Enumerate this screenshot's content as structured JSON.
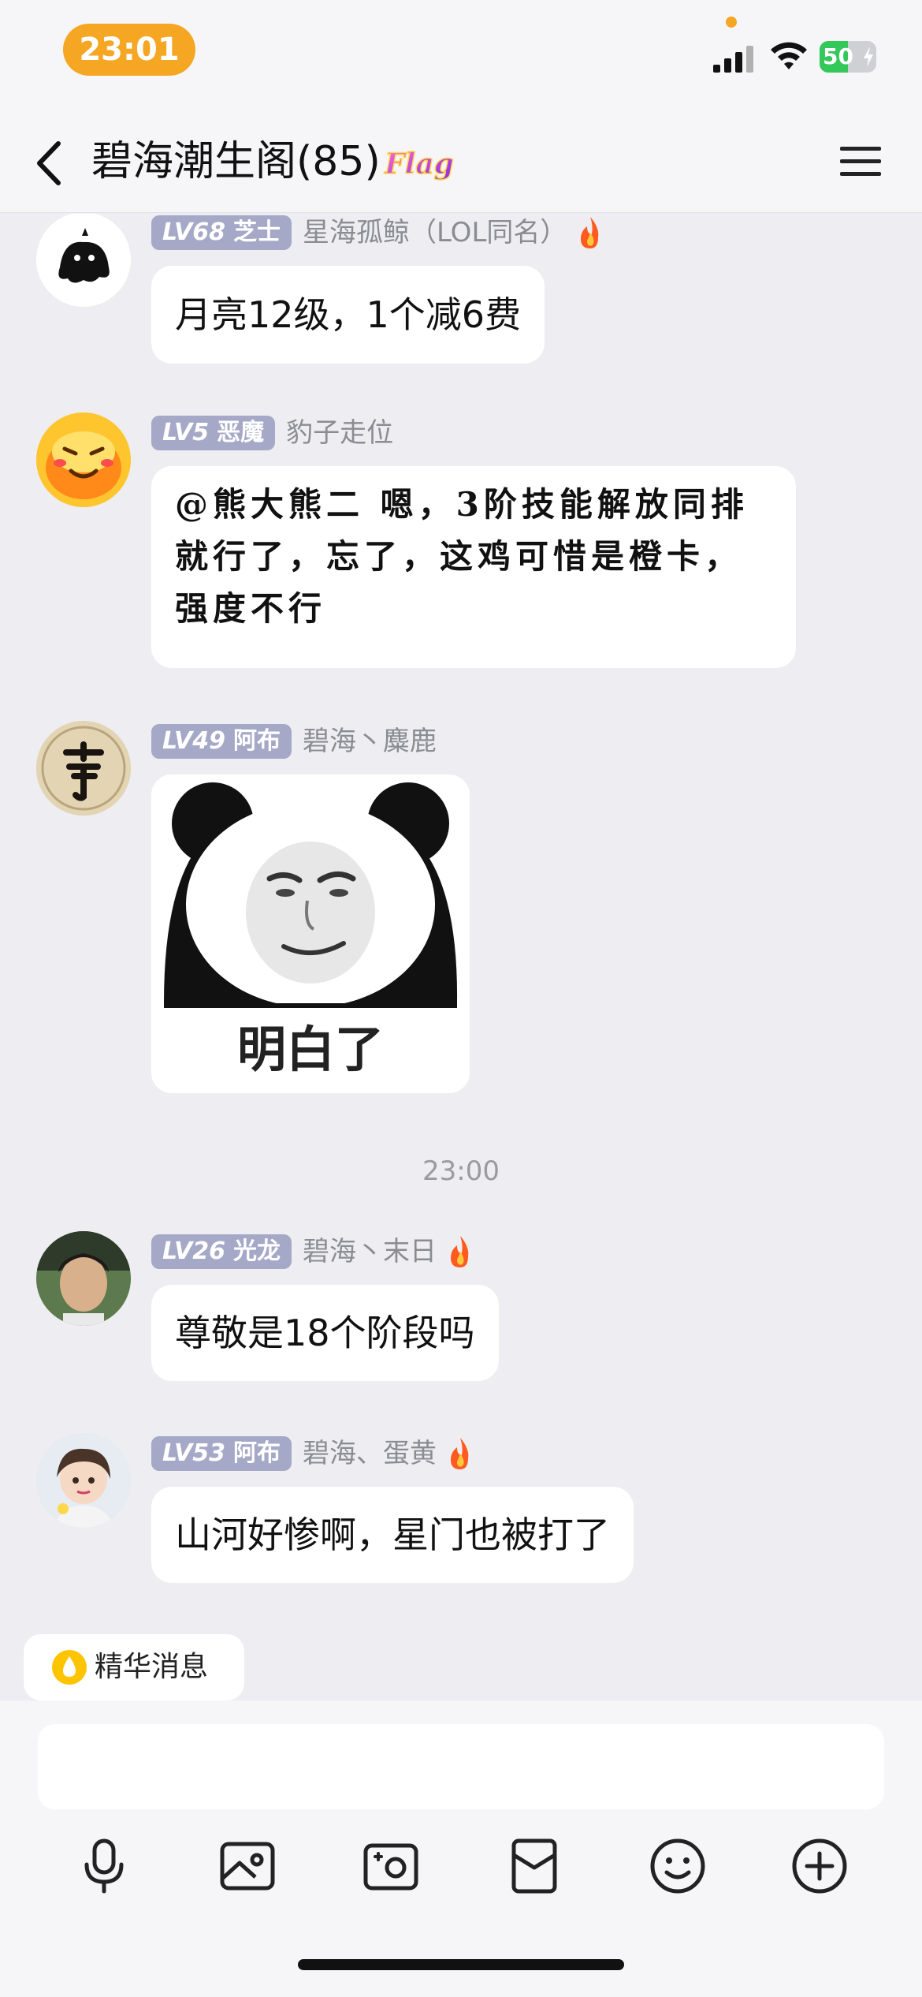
{
  "status_bar": {
    "time": "23:01",
    "battery": "50",
    "battery_level": 0.5,
    "colors": {
      "time_pill": "#f5a623",
      "battery": "#34c759"
    }
  },
  "header": {
    "title": "碧海潮生阁(85)",
    "badge_text": "Flag",
    "back_icon": "chevron-left-icon",
    "menu_icon": "hamburger-menu-icon"
  },
  "messages": [
    {
      "level": "LV68",
      "title": "芝士",
      "nickname": "星海孤鲸（LOL同名）",
      "hot": true,
      "text": "月亮12级，1个减6费"
    },
    {
      "level": "LV5",
      "title": "恶魔",
      "nickname": "豹子走位",
      "hot": false,
      "text": "@熊大熊二 嗯，3阶技能解放同排就行了，忘了，这鸡可惜是橙卡，强度不行"
    },
    {
      "level": "LV49",
      "title": "阿布",
      "nickname": "碧海丶麋鹿",
      "hot": false,
      "sticker_text": "明白了"
    },
    {
      "level": "LV26",
      "title": "光龙",
      "nickname": "碧海丶末日",
      "hot": true,
      "text": "尊敬是18个阶段吗"
    },
    {
      "level": "LV53",
      "title": "阿布",
      "nickname": "碧海、蛋黄",
      "hot": true,
      "text": "山河好惨啊，星门也被打了"
    }
  ],
  "timestamp": "23:00",
  "essence": {
    "label": "精华消息"
  },
  "input": {
    "placeholder": ""
  },
  "toolbar": [
    "microphone-icon",
    "image-icon",
    "camera-icon",
    "red-packet-icon",
    "emoji-icon",
    "plus-icon"
  ],
  "colors": {
    "level_badge": "#a5a9c7",
    "background": "#ededf2",
    "bubble": "#ffffff"
  }
}
